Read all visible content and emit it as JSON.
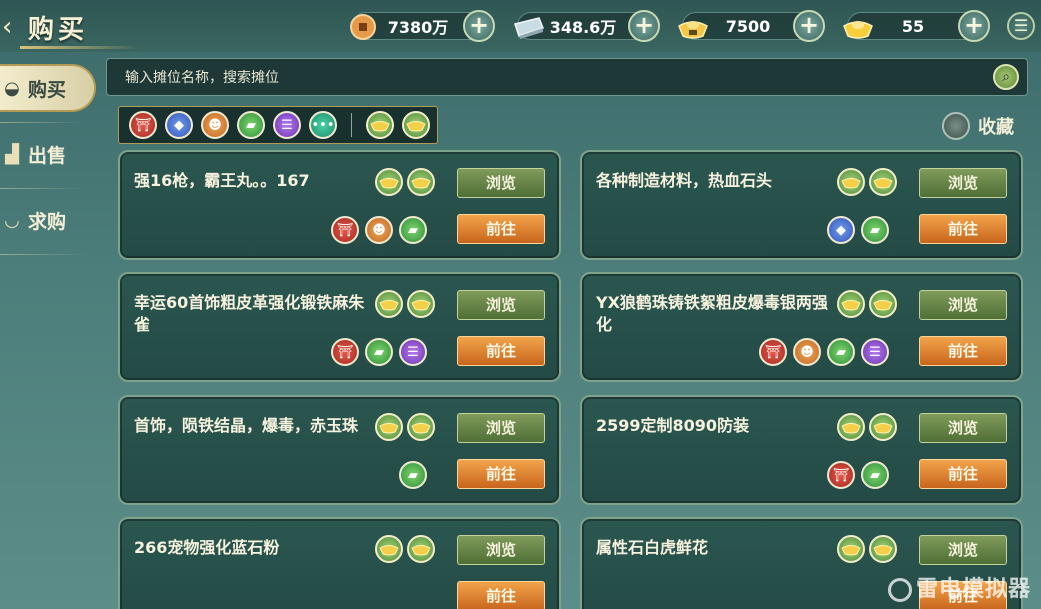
{
  "header": {
    "title": "购买",
    "currencies": [
      {
        "icon": "copper-coin-icon",
        "value": "7380万"
      },
      {
        "icon": "silver-ingot-icon",
        "value": "348.6万"
      },
      {
        "icon": "gold-ingot-bound-icon",
        "value": "7500"
      },
      {
        "icon": "gold-ingot-icon",
        "value": "55"
      }
    ]
  },
  "sidebar": {
    "items": [
      {
        "label": "购买",
        "icon": "ingot-icon",
        "active": true
      },
      {
        "label": "出售",
        "icon": "bag-icon",
        "active": false
      },
      {
        "label": "求购",
        "icon": "bowl-icon",
        "active": false
      }
    ]
  },
  "search": {
    "placeholder": "输入摊位名称，搜索摊位"
  },
  "filters": {
    "categories": [
      "weapon-icon",
      "gem-icon",
      "pet-icon",
      "material-icon",
      "scroll-icon",
      "more-icon"
    ],
    "currencies": [
      "gold-ingot-icon",
      "gold-ingot-icon"
    ]
  },
  "favorite": {
    "label": "收藏"
  },
  "buttons": {
    "view": "浏览",
    "go": "前往"
  },
  "listings": [
    {
      "name": "强16枪，霸王丸。。167",
      "cats": [
        "red",
        "orange",
        "green"
      ]
    },
    {
      "name": "各种制造材料，热血石头",
      "cats": [
        "blue",
        "green"
      ]
    },
    {
      "name": "幸运60首饰粗皮革强化锻铁麻朱雀",
      "cats": [
        "red",
        "green",
        "purple"
      ]
    },
    {
      "name": "YX狼鹤珠铸铁絮粗皮爆毒银两强化",
      "cats": [
        "red",
        "orange",
        "green",
        "purple"
      ]
    },
    {
      "name": "首饰，陨铁结晶，爆毒，赤玉珠",
      "cats": [
        "green"
      ]
    },
    {
      "name": "2599定制8090防装",
      "cats": [
        "red",
        "green"
      ]
    },
    {
      "name": "266宠物强化蓝石粉",
      "cats": []
    },
    {
      "name": "属性石白虎鲜花",
      "cats": []
    }
  ],
  "watermark": "雷电模拟器"
}
